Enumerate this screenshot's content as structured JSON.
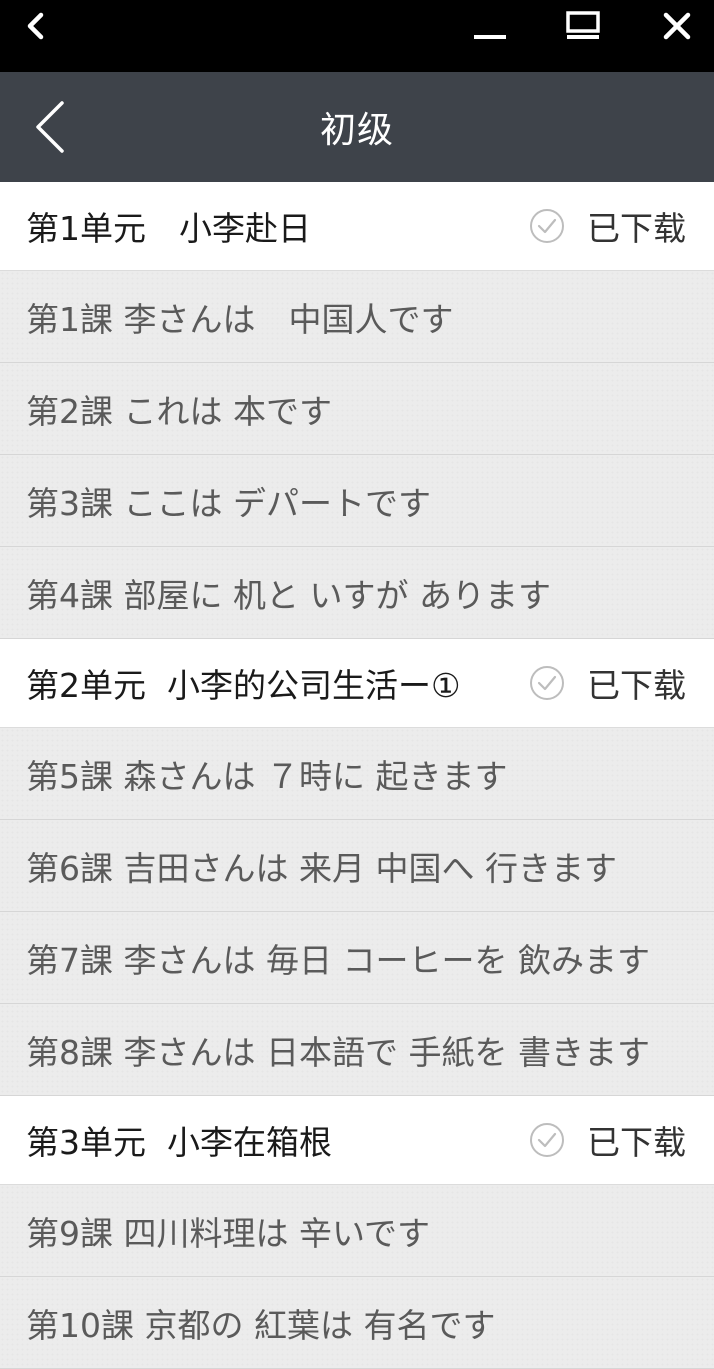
{
  "nav": {
    "title": "初级"
  },
  "units": [
    {
      "title": "第1单元　小李赴日",
      "status": "已下载",
      "lessons": [
        "第1課 李さんは　中国人です",
        "第2課 これは 本です",
        "第3課 ここは デパートです",
        "第4課 部屋に 机と いすが あります"
      ]
    },
    {
      "title": "第2单元  小李的公司生活ー①",
      "status": "已下载",
      "lessons": [
        "第5課 森さんは ７時に 起きます",
        "第6課 吉田さんは 来月 中国へ 行きます",
        "第7課 李さんは 毎日 コーヒーを 飲みます",
        "第8課 李さんは 日本語で 手紙を 書きます"
      ]
    },
    {
      "title": "第3单元  小李在箱根",
      "status": "已下载",
      "lessons": [
        "第9課 四川料理は 辛いです",
        "第10課 京都の 紅葉は 有名です"
      ]
    }
  ],
  "icons": {
    "system_back": "chevron-left-icon",
    "minimize": "minimize-icon",
    "maximize": "maximize-icon",
    "close": "close-icon",
    "nav_back": "back-arrow-icon",
    "downloaded": "check-circle-icon"
  },
  "colors": {
    "system_bar": "#000000",
    "nav_bar": "#3e434a",
    "unit_bg": "#ffffff",
    "lesson_bg": "#ececec"
  }
}
